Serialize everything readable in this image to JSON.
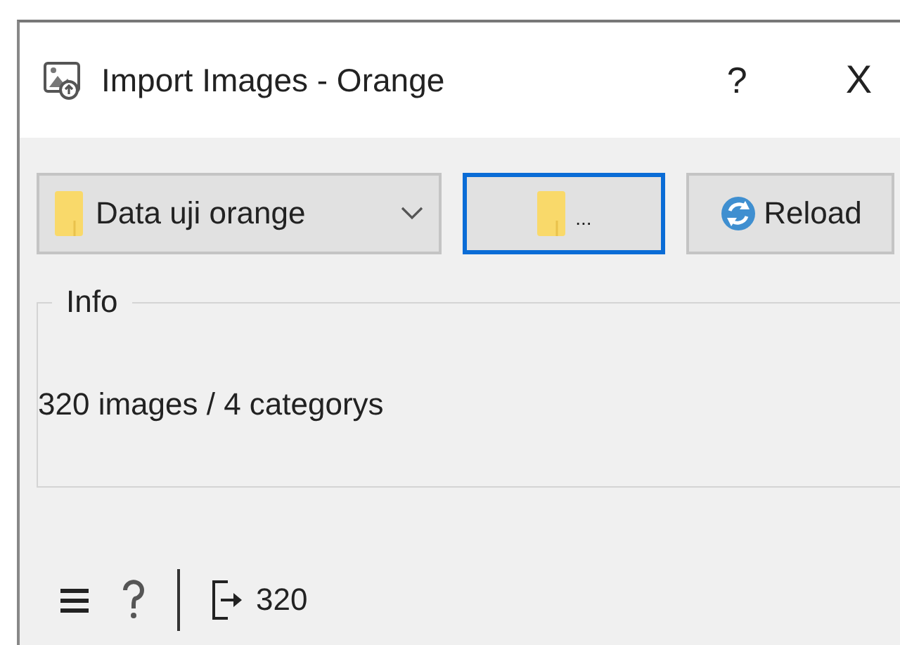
{
  "window": {
    "title": "Import Images - Orange",
    "help": "?",
    "close": "X"
  },
  "toolbar": {
    "folder_combo": {
      "value": "Data uji orange"
    },
    "browse_button": {
      "label": "...",
      "focused": true
    },
    "reload_button": {
      "label": "Reload"
    }
  },
  "info": {
    "title": "Info",
    "text": "320 images / 4 categorys"
  },
  "status_bar": {
    "output_count": "320"
  }
}
